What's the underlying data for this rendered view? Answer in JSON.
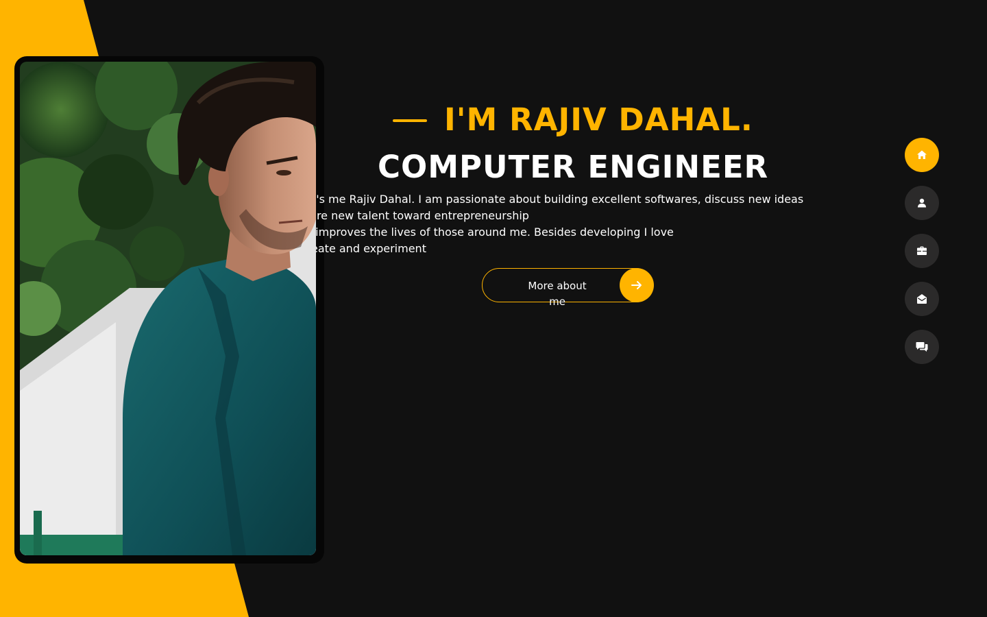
{
  "hero": {
    "intro": "I'M RAJIV DAHAL.",
    "role": "COMPUTER ENGINEER",
    "bio_lines": [
      "! it's me Rajiv Dahal. I am passionate about building excellent softwares, discuss new ideas",
      "spire new talent toward entrepreneurship",
      "at improves the lives of those around me. Besides developing I love",
      " create and experiment"
    ],
    "button_label": "More about me",
    "button_icon": "arrow-right-icon",
    "portrait": "portrait-photo"
  },
  "nav": {
    "items": [
      {
        "name": "home",
        "icon": "home-icon",
        "active": true
      },
      {
        "name": "about",
        "icon": "user-icon",
        "active": false
      },
      {
        "name": "portfolio",
        "icon": "briefcase-icon",
        "active": false
      },
      {
        "name": "contact",
        "icon": "envelope-open-icon",
        "active": false
      },
      {
        "name": "blog",
        "icon": "comments-icon",
        "active": false
      }
    ]
  },
  "colors": {
    "accent": "#ffb400",
    "background": "#111111",
    "nav_inactive": "#2b2a2a",
    "text": "#ffffff"
  }
}
